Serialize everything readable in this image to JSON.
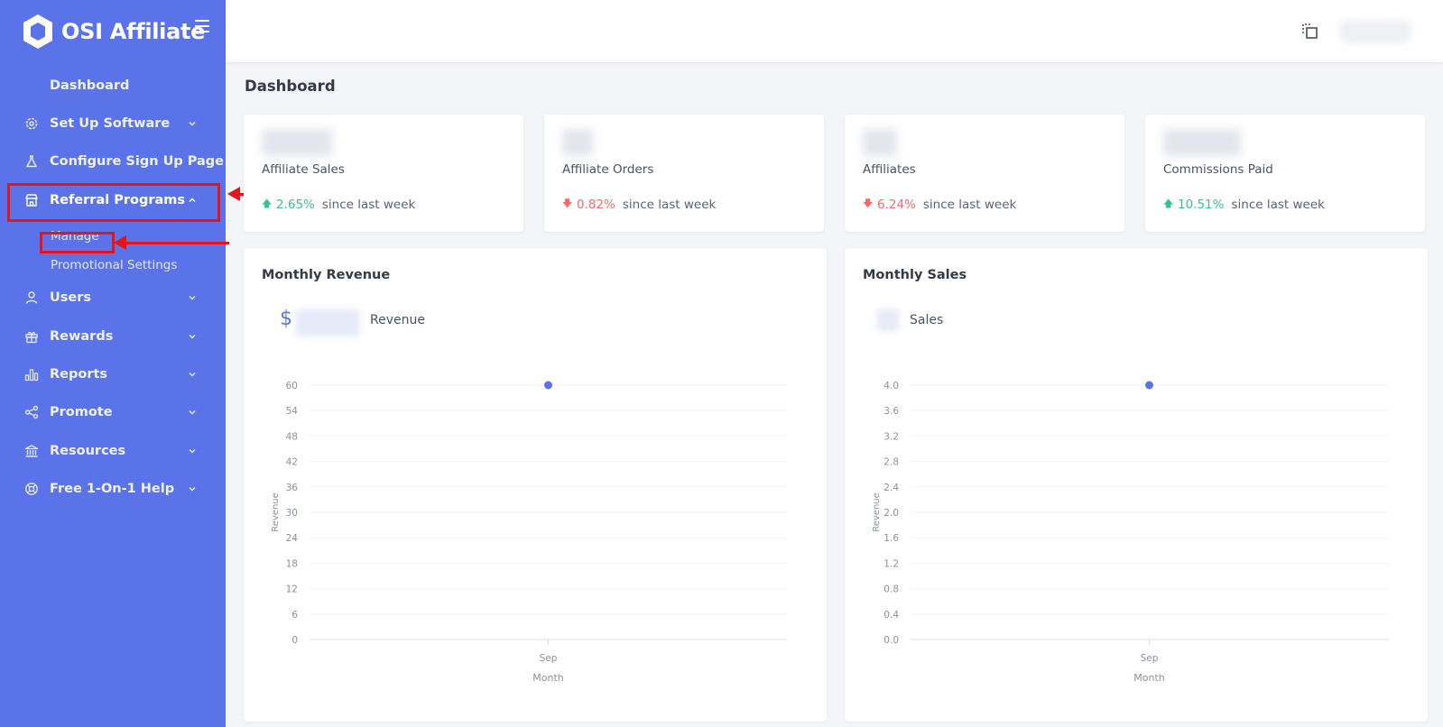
{
  "app": {
    "name": "OSI Affiliate"
  },
  "sidebar": {
    "items": [
      {
        "label": "Dashboard",
        "icon": "none",
        "expandable": false
      },
      {
        "label": "Set Up Software",
        "icon": "gear-icon",
        "expandable": true
      },
      {
        "label": "Configure Sign Up Page",
        "icon": "flask-icon",
        "expandable": false
      },
      {
        "label": "Referral Programs",
        "icon": "store-icon",
        "expandable": true,
        "expanded": true
      },
      {
        "label": "Users",
        "icon": "user-icon",
        "expandable": true
      },
      {
        "label": "Rewards",
        "icon": "gift-icon",
        "expandable": true
      },
      {
        "label": "Reports",
        "icon": "bar-chart-icon",
        "expandable": true
      },
      {
        "label": "Promote",
        "icon": "share-icon",
        "expandable": true
      },
      {
        "label": "Resources",
        "icon": "bank-icon",
        "expandable": true
      },
      {
        "label": "Free 1-On-1 Help",
        "icon": "lifebuoy-icon",
        "expandable": true
      }
    ],
    "subitems": [
      {
        "label": "Manage"
      },
      {
        "label": "Promotional Settings"
      }
    ]
  },
  "page": {
    "title": "Dashboard"
  },
  "stats": [
    {
      "label": "Affiliate Sales",
      "change": "2.65%",
      "direction": "up",
      "since": "since last week"
    },
    {
      "label": "Affiliate Orders",
      "change": "0.82%",
      "direction": "down",
      "since": "since last week"
    },
    {
      "label": "Affiliates",
      "change": "6.24%",
      "direction": "down",
      "since": "since last week"
    },
    {
      "label": "Commissions Paid",
      "change": "10.51%",
      "direction": "up",
      "since": "since last week"
    }
  ],
  "colors": {
    "sidebar": "#5b73e8",
    "accent": "#5b73e8",
    "up": "#34c38f",
    "down": "#f46a6a",
    "annotation": "#e8121a"
  },
  "charts": [
    {
      "title": "Monthly Revenue",
      "currency_symbol": "$",
      "metric_label": "Revenue",
      "chart_data": {
        "type": "scatter",
        "categories": [
          "Sep"
        ],
        "values": [
          60
        ],
        "xlabel": "Month",
        "ylabel": "Revenue",
        "ylim": [
          0,
          60
        ],
        "yticks": [
          "0",
          "6",
          "12",
          "18",
          "24",
          "30",
          "36",
          "42",
          "48",
          "54",
          "60"
        ],
        "grid": true
      }
    },
    {
      "title": "Monthly Sales",
      "metric_label": "Sales",
      "chart_data": {
        "type": "scatter",
        "categories": [
          "Sep"
        ],
        "values": [
          4.0
        ],
        "xlabel": "Month",
        "ylabel": "Revenue",
        "ylim": [
          0,
          4.0
        ],
        "yticks": [
          "0.0",
          "0.4",
          "0.8",
          "1.2",
          "1.6",
          "2.0",
          "2.4",
          "2.8",
          "3.2",
          "3.6",
          "4.0"
        ],
        "grid": true
      }
    }
  ]
}
